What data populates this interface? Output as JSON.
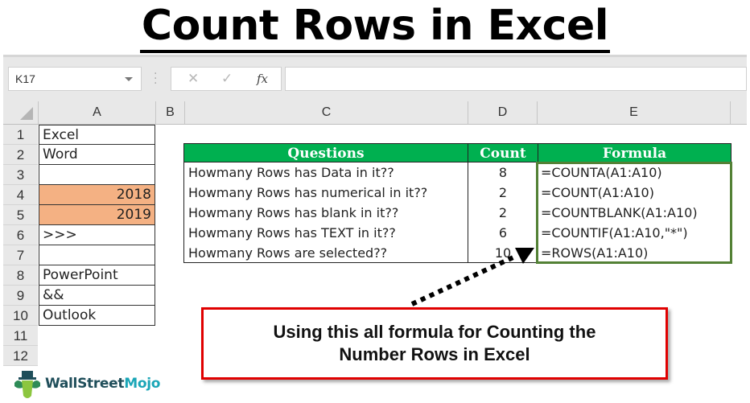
{
  "title": "Count Rows in Excel",
  "toolbar": {
    "name_box": "K17",
    "cancel_icon": "✕",
    "enter_icon": "✓",
    "fx_label": "fx",
    "formula_value": ""
  },
  "columns": [
    "A",
    "B",
    "C",
    "D",
    "E"
  ],
  "row_numbers": [
    "1",
    "2",
    "3",
    "4",
    "5",
    "6",
    "7",
    "8",
    "9",
    "10",
    "11",
    "12"
  ],
  "column_a": [
    "Excel",
    "Word",
    "",
    "2018",
    "2019",
    ">>>",
    "",
    "PowerPoint",
    "&&",
    "Outlook"
  ],
  "table": {
    "headers": {
      "questions": "Questions",
      "count": "Count",
      "formula": "Formula"
    },
    "rows": [
      {
        "question": "Howmany Rows has Data in it??",
        "count": "8",
        "formula": "=COUNTA(A1:A10)"
      },
      {
        "question": "Howmany Rows has numerical in it??",
        "count": "2",
        "formula": "=COUNT(A1:A10)"
      },
      {
        "question": "Howmany Rows has blank in it??",
        "count": "2",
        "formula": "=COUNTBLANK(A1:A10)"
      },
      {
        "question": "Howmany Rows has TEXT in it??",
        "count": "6",
        "formula": "=COUNTIF(A1:A10,\"*\")"
      },
      {
        "question": "Howmany Rows are selected??",
        "count": "10",
        "formula": "=ROWS(A1:A10)"
      }
    ]
  },
  "callout": {
    "line1": "Using this all formula for Counting the",
    "line2": "Number Rows in Excel"
  },
  "logo": {
    "part1": "WallStreet",
    "part2": "Mojo"
  },
  "colors": {
    "header_green": "#00b050",
    "formula_border": "#538135",
    "highlight": "#f4b183",
    "callout_border": "#e00000"
  }
}
